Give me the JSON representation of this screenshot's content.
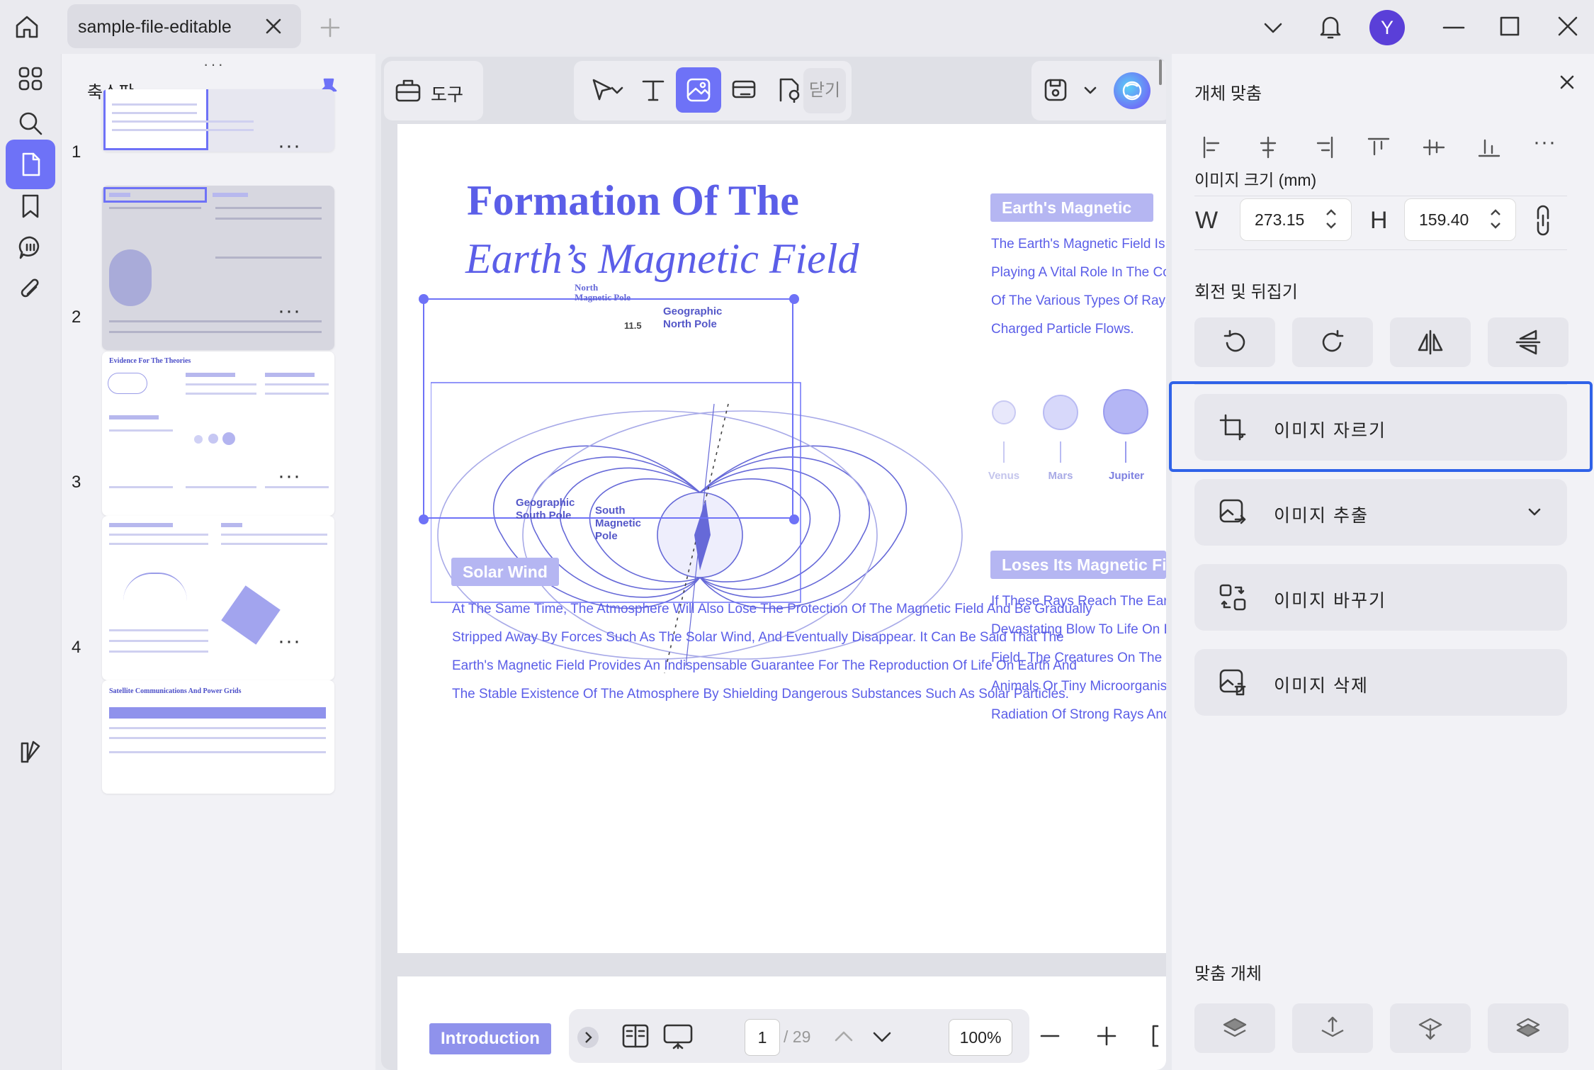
{
  "tab": {
    "title": "sample-file-editable"
  },
  "thumbnails": {
    "title": "축소판",
    "pages": [
      {
        "num": "1"
      },
      {
        "num": "2"
      },
      {
        "num": "3",
        "heading": "Evidence For The Theories"
      },
      {
        "num": "4"
      },
      {
        "heading": "Satellite Communications And Power Grids"
      }
    ]
  },
  "toolbar": {
    "tools_label": "도구",
    "close_label": "닫기"
  },
  "document": {
    "title_line1": "Formation Of The",
    "title_line2": "Earth’s Magnetic Field",
    "earth_tag": "Earth's Magnetic",
    "earth_lines": [
      "The Earth's Magnetic Field Is",
      "Playing A Vital Role In The Co",
      "Of The Various Types Of Rays",
      "Charged Particle Flows."
    ],
    "planets": [
      "Venus",
      "Mars",
      "Jupiter"
    ],
    "loses_tag": "Loses Its Magnetic Fiel",
    "loses_lines": [
      "If These Rays Reach The Ear",
      "Devastating Blow To Life On E",
      "Field, The Creatures On The E",
      "Animals Or Tiny Microorganis",
      "Radiation Of Strong Rays And"
    ],
    "diagram": {
      "north_magnetic": "North Magnetic Pole",
      "geo_north": [
        "Geographic",
        "North Pole"
      ],
      "angle": "11.5",
      "geo_south": [
        "Geographic",
        "South Pole"
      ],
      "south_magnetic": [
        "South",
        "Magnetic",
        "Pole"
      ]
    },
    "solar_tag": "Solar Wind",
    "solar_lines": [
      "At The Same Time, The Atmosphere Will Also Lose The Protection Of The Magnetic Field And Be Gradually",
      "Stripped Away By Forces Such As The Solar Wind, And Eventually Disappear. It Can Be Said That The",
      "Earth's Magnetic Field Provides An Indispensable Guarantee For The Reproduction Of Life On Earth And",
      "The Stable Existence Of The Atmosphere By Shielding Dangerous Substances Such As Solar Particles."
    ],
    "page2_tag": "Introduction"
  },
  "nav": {
    "current_page": "1",
    "total": "/ 29",
    "zoom": "100%"
  },
  "panel": {
    "align_title": "개체 맞춤",
    "size_title": "이미지 크기 (mm)",
    "w_label": "W",
    "w_value": "273.15",
    "h_label": "H",
    "h_value": "159.40",
    "rotate_title": "회전 및 뒤집기",
    "crop": "이미지 자르기",
    "extract": "이미지 추출",
    "replace": "이미지 바꾸기",
    "delete": "이미지 삭제",
    "arrange_title": "맞춤 개체"
  },
  "user": {
    "avatar_letter": "Y"
  },
  "colors": {
    "accent": "#6e72f7",
    "doc_purple": "#5b5ee8",
    "highlight_border": "#2f62e8"
  }
}
